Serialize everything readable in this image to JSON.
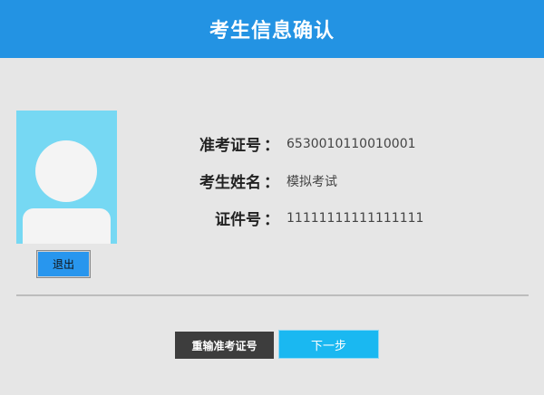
{
  "header": {
    "title": "考生信息确认"
  },
  "photo": {
    "icon": "user-silhouette-icon"
  },
  "buttons": {
    "exit": "退出",
    "reenter": "重输准考证号",
    "next": "下一步"
  },
  "info": [
    {
      "label": "准考证号",
      "value": "6530010110010001"
    },
    {
      "label": "考生姓名",
      "value": "模拟考试"
    },
    {
      "label": "证件号",
      "value": "11111111111111111"
    }
  ],
  "colon": "：",
  "colors": {
    "header_bg": "#2393e3",
    "photo_bg": "#76d8f3",
    "next_bg": "#1ab8f1",
    "reenter_bg": "#3d3d3d",
    "exit_bg": "#2896ee"
  }
}
